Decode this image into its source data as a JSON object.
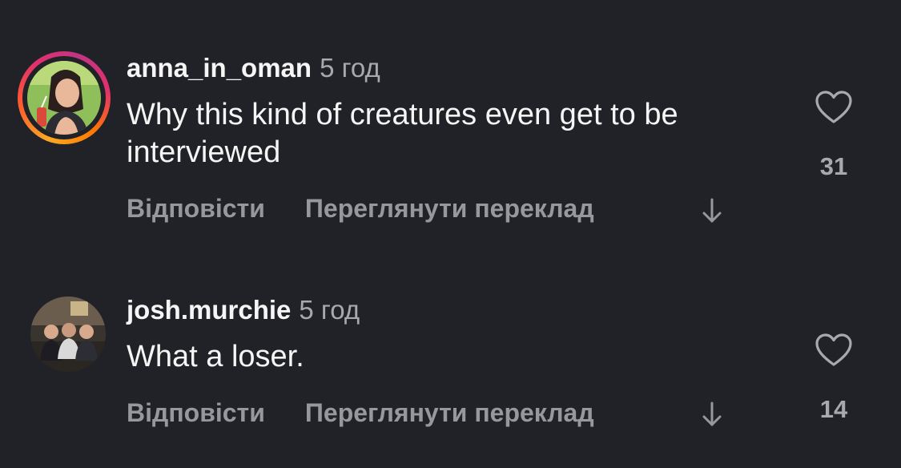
{
  "comments": [
    {
      "username": "anna_in_oman",
      "time": "5 год",
      "text": "Why this kind of creatures even get to be interviewed",
      "reply_label": "Відповісти",
      "translate_label": "Переглянути переклад",
      "likes": "31",
      "has_story_ring": true
    },
    {
      "username": "josh.murchie",
      "time": "5 год",
      "text": "What a loser.",
      "reply_label": "Відповісти",
      "translate_label": "Переглянути переклад",
      "likes": "14",
      "has_story_ring": false
    }
  ],
  "colors": {
    "background": "#202227",
    "primary_text": "#f5f5f5",
    "secondary_text": "#97989c",
    "story_ring_start": "#f9a825",
    "story_ring_end": "#c13584"
  },
  "icons": {
    "like": "heart-outline-icon",
    "menu": "arrow-down-icon"
  }
}
